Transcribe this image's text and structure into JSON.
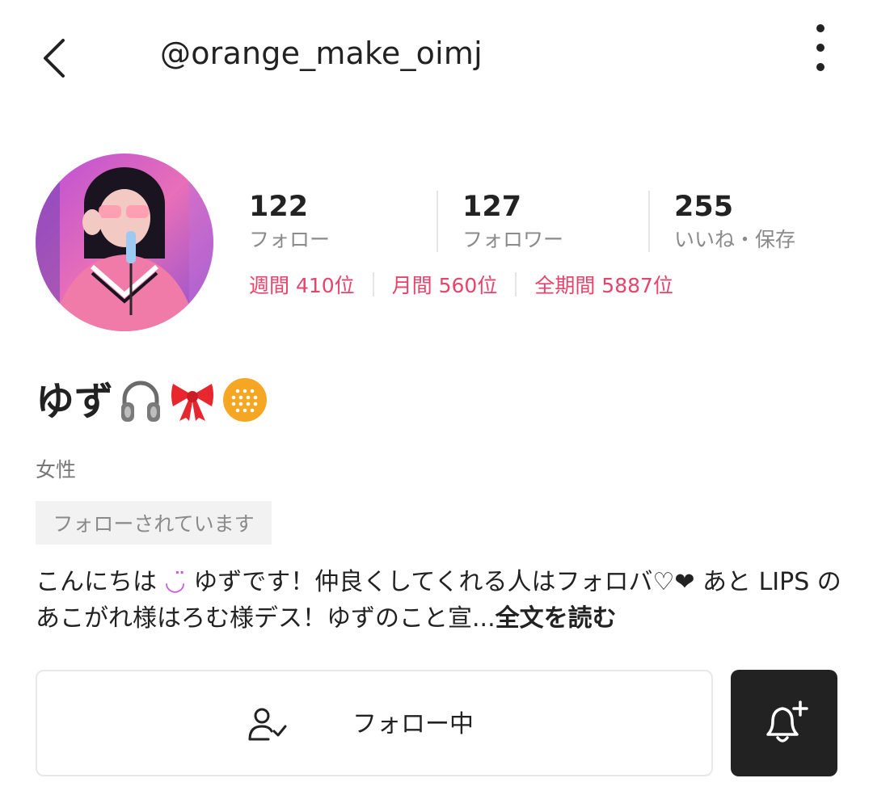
{
  "header": {
    "username": "@orange_make_oimj"
  },
  "stats": [
    {
      "value": "122",
      "label": "フォロー"
    },
    {
      "value": "127",
      "label": "フォロワー"
    },
    {
      "value": "255",
      "label": "いいね・保存"
    }
  ],
  "ranks": [
    "週間 410位",
    "月間 560位",
    "全期間 5887位"
  ],
  "profile": {
    "name": "ゆず",
    "gender": "女性",
    "followed_badge": "フォローされています",
    "bio_part1": "こんにちは",
    "bio_smile": "◡̈",
    "bio_part2": " ゆずです！仲良くしてくれる人はフォロバ♡❤ あと LIPS のあこがれ様はろむ様デス！ゆずのこと宣...",
    "read_more": "全文を読む"
  },
  "actions": {
    "following_label": "フォロー中"
  },
  "icons": {
    "back": "chevron-left-icon",
    "more": "more-vertical-icon",
    "headphones": "headphones-icon",
    "ribbon": "ribbon-icon",
    "badge": "orange-badge-icon",
    "user_check": "user-check-icon",
    "bell_plus": "bell-plus-icon"
  },
  "colors": {
    "rank_pink": "#e8436b",
    "bell_bg": "#222222",
    "badge_orange": "#f5a623",
    "ribbon_red": "#e8262e"
  }
}
